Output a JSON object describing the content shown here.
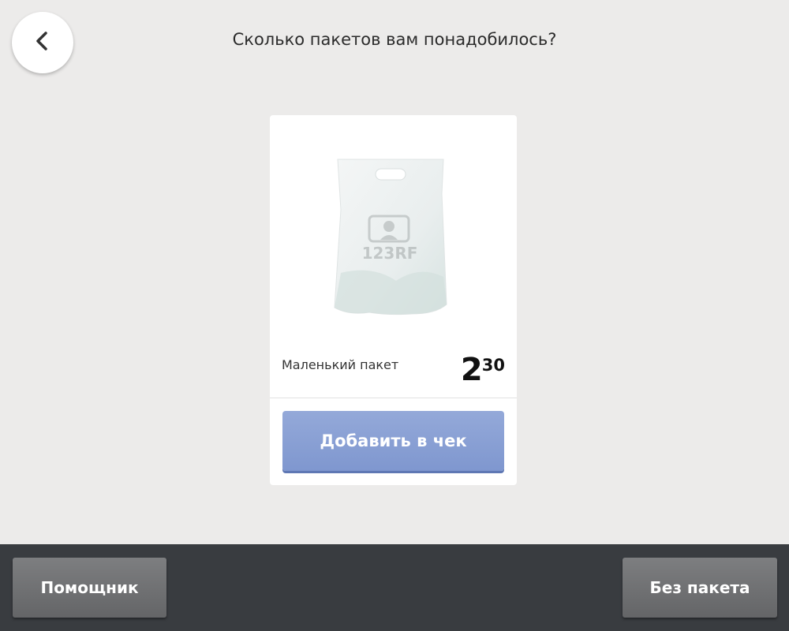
{
  "header": {
    "back_icon": "chevron-left-icon",
    "title": "Сколько пакетов вам понадобилось?"
  },
  "product": {
    "name": "Маленький пакет",
    "price_main": "2",
    "price_cents": "30",
    "image_icon": "plastic-bag-image",
    "watermark": "123RF",
    "add_button_label": "Добавить в чек"
  },
  "bottom_bar": {
    "helper_label": "Помощник",
    "no_bag_label": "Без пакета"
  },
  "colors": {
    "background": "#ecebea",
    "accent_button": "#8aa0d5",
    "bottom_bar": "#393c40",
    "bottom_button": "#6f7072"
  }
}
